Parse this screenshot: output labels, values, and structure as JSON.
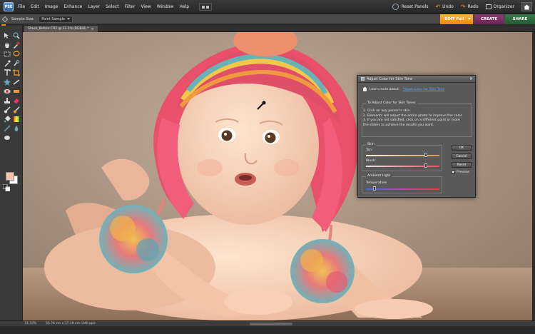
{
  "app": {
    "logo_text": "PSE"
  },
  "menu": [
    "File",
    "Edit",
    "Image",
    "Enhance",
    "Layer",
    "Select",
    "Filter",
    "View",
    "Window",
    "Help"
  ],
  "menu_right": {
    "reset_panels": "Reset Panels",
    "undo": "Undo",
    "redo": "Redo",
    "organizer": "Organizer"
  },
  "mode_buttons": {
    "edit_full": "EDIT Full",
    "create": "CREATE",
    "share": "SHARE"
  },
  "options": {
    "sample_size_label": "Sample Size:",
    "sample_size_value": "Point Sample"
  },
  "document": {
    "tab_title": "Shock_Before.CR2 @ 33.3% (RGB/8) *",
    "zoom": "33.33%",
    "doc_size": "55.76 cm x 37.19 cm (240 ppi)"
  },
  "colors": {
    "foreground": "#f2c4ad",
    "background": "#ffffff",
    "accent": "#f08a00"
  },
  "dialog": {
    "title": "Adjust Color for Skin Tone",
    "learn_prefix": "Learn more about:",
    "learn_link": "Adjust Color for Skin Tone",
    "instructions_heading": "To Adjust Color for Skin Tones",
    "instructions": [
      "1. Click on any person's skin.",
      "2. Elements will adjust the entire photo to improve the color.",
      "3. If you are not satisfied, click on a different point or more",
      "    the sliders to achieve the results you want."
    ],
    "skin_group": "Skin",
    "tan_label": "Tan:",
    "tan_value": 0.82,
    "blush_label": "Blush:",
    "blush_value": 0.82,
    "ambient_group": "Ambient Light",
    "temperature_label": "Temperature",
    "temperature_value": 0.12,
    "ok": "OK",
    "cancel": "Cancel",
    "reset": "Reset",
    "preview": "Preview",
    "preview_checked": true
  }
}
